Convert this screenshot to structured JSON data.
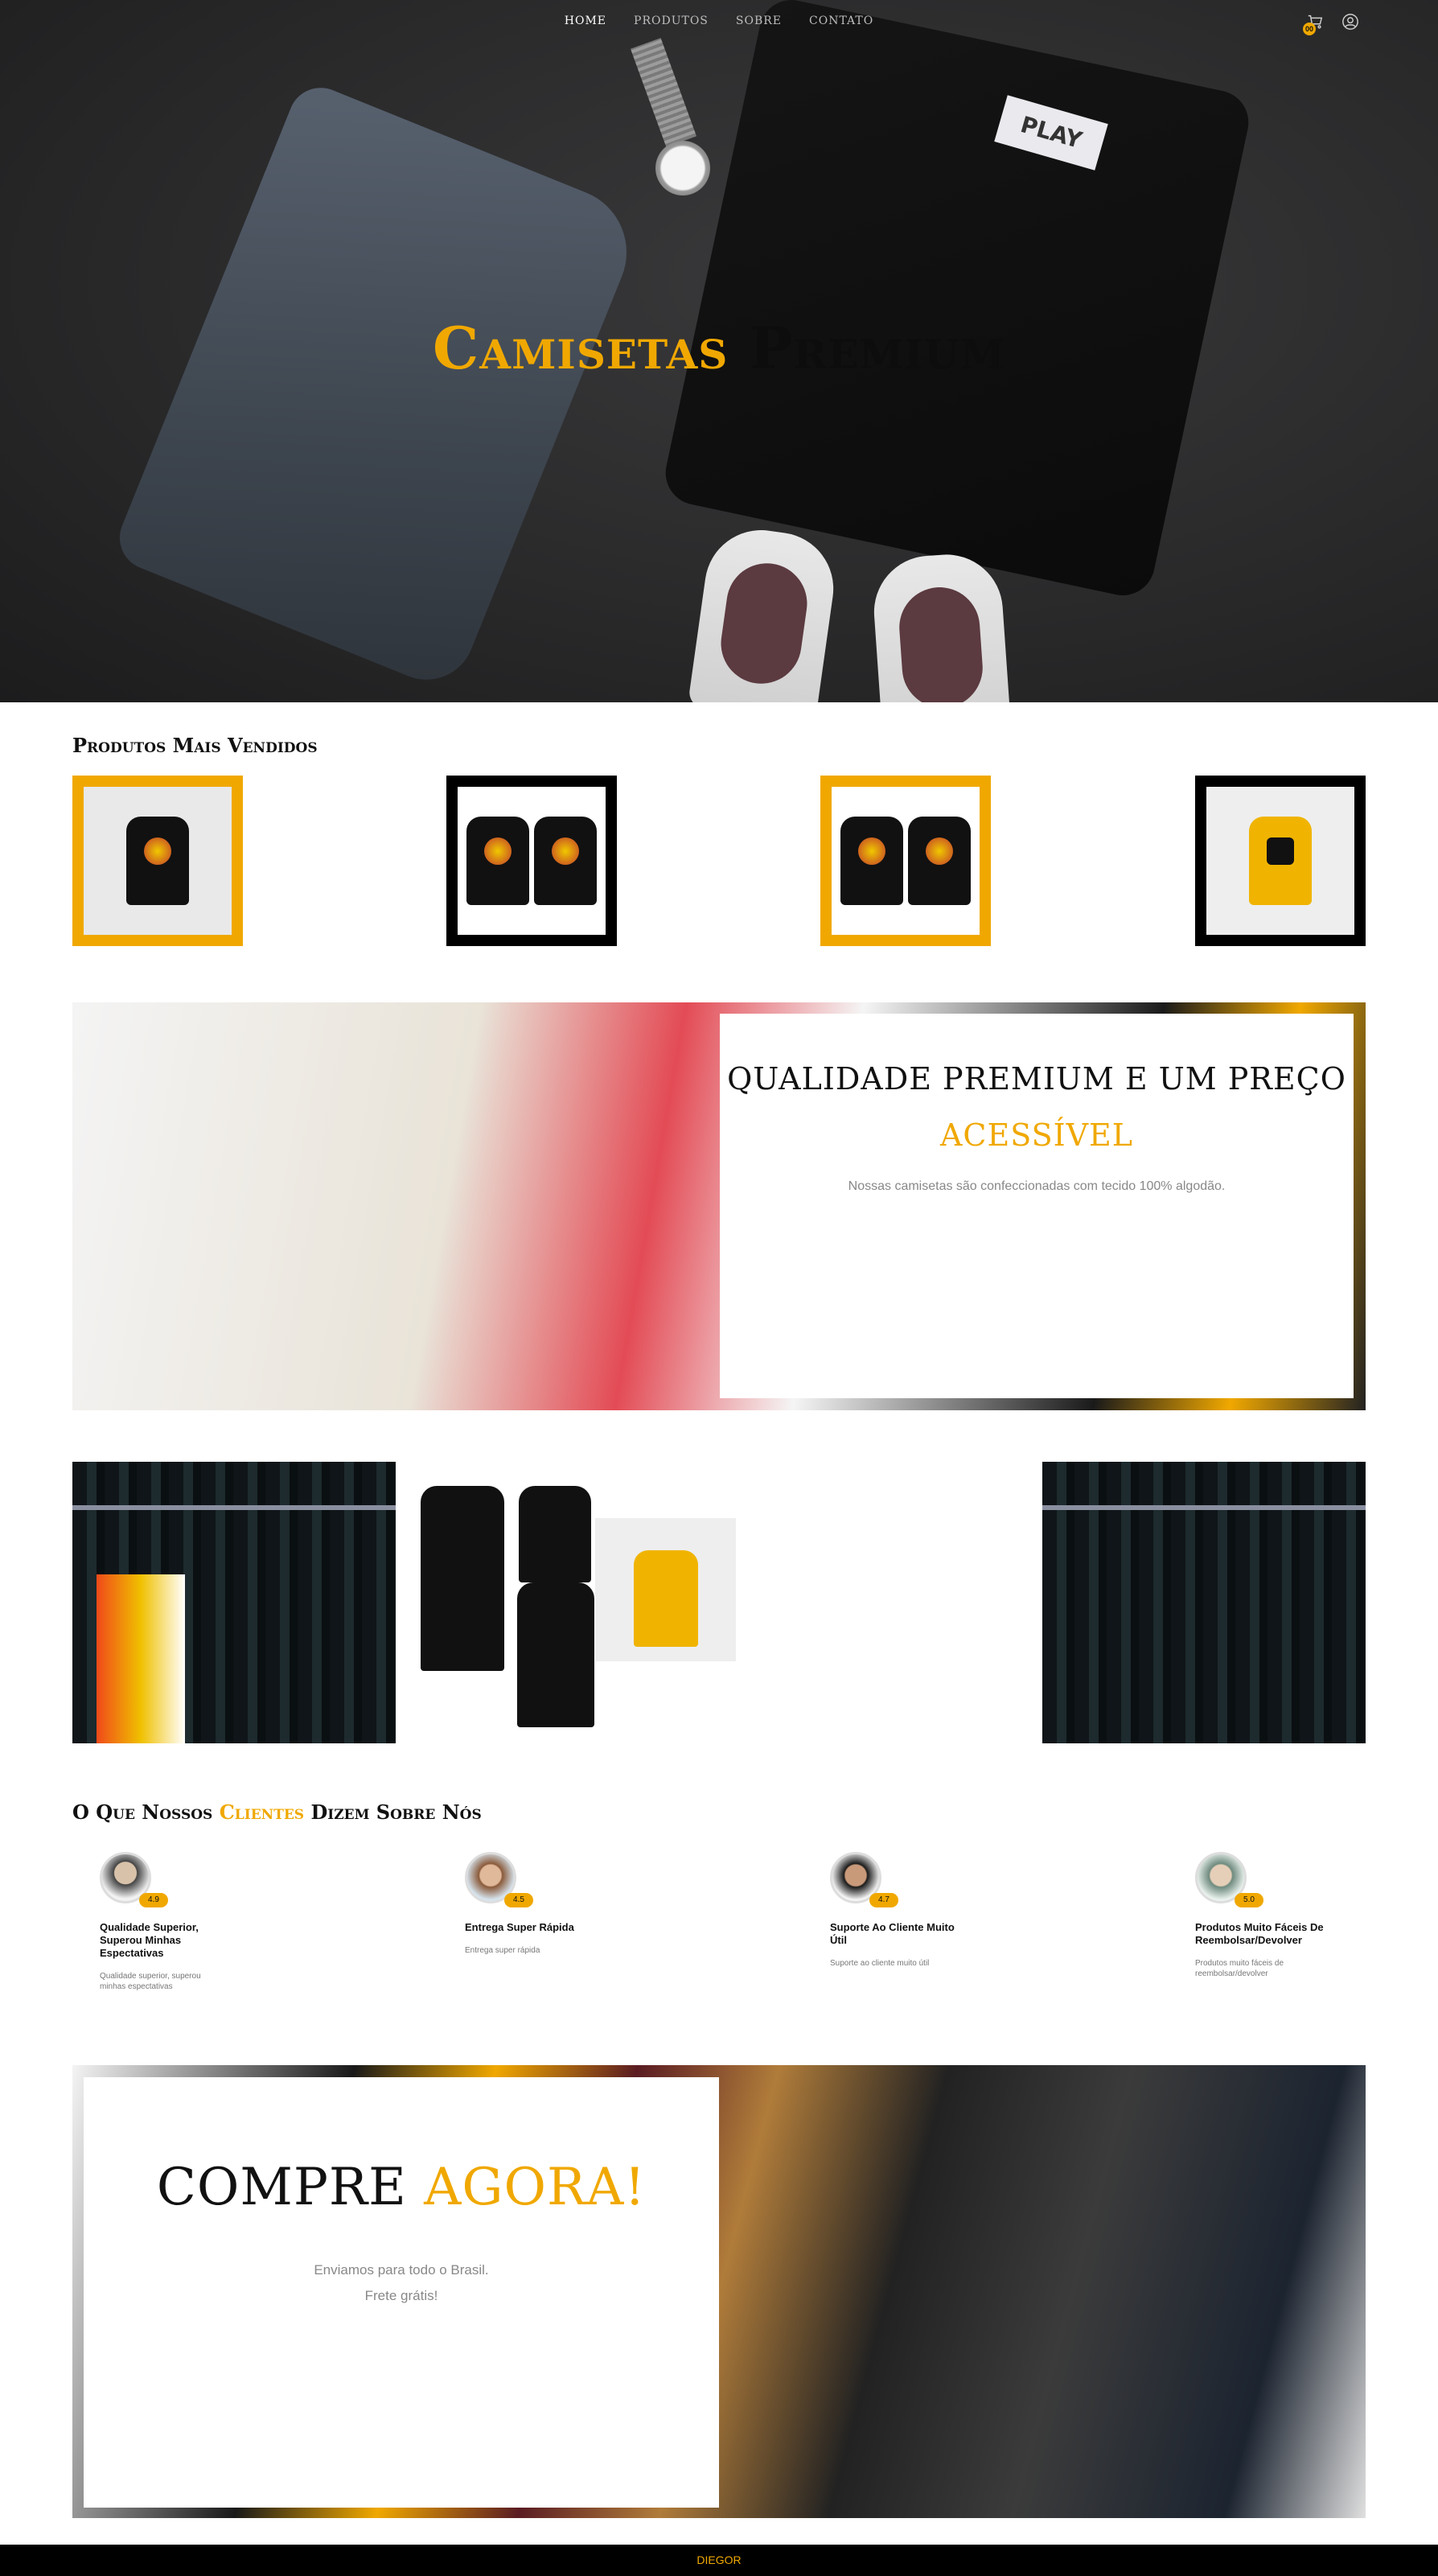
{
  "nav": {
    "items": [
      "HOME",
      "PRODUTOS",
      "SOBRE",
      "CONTATO"
    ],
    "active": "HOME",
    "cart_count": "00"
  },
  "hero": {
    "title_word1": "Camisetas",
    "title_word2": "Premium",
    "shirt_tag": "PLAY"
  },
  "best_sellers": {
    "title": "Produtos Mais Vendidos"
  },
  "feature": {
    "headline_part1": "QUALIDADE PREMIUM E UM PREÇO",
    "headline_part2": "ACESSÍVEL",
    "text": "Nossas camisetas são confeccionadas com tecido 100% algodão."
  },
  "testimonials": {
    "title_part1": "O Que Nossos",
    "title_part2": "Clientes",
    "title_part3": "Dizem Sobre Nós",
    "items": [
      {
        "rating": "4.9",
        "title": "Qualidade Superior, Superou Minhas Espectativas",
        "text": "Qualidade superior, superou minhas espectativas"
      },
      {
        "rating": "4.5",
        "title": "Entrega Super Rápida",
        "text": "Entrega super rápida"
      },
      {
        "rating": "4.7",
        "title": "Suporte Ao Cliente Muito Útil",
        "text": "Suporte ao cliente muito útil"
      },
      {
        "rating": "5.0",
        "title": "Produtos Muito Fáceis De Reembolsar/Devolver",
        "text": "Produtos muito fáceis de reembolsar/devolver"
      }
    ]
  },
  "cta": {
    "headline_part1": "COMPRE",
    "headline_part2": "AGORA!",
    "line1": "Enviamos para todo o Brasil.",
    "line2": "Frete grátis!"
  },
  "footer": {
    "text": "DIEGOR"
  },
  "colors": {
    "accent": "#f0a800",
    "dark": "#000000"
  }
}
